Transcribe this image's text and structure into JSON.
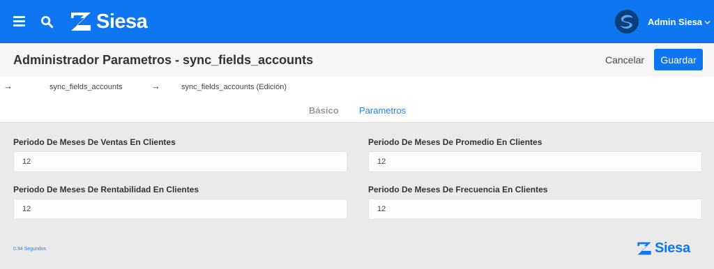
{
  "header": {
    "brand_name": "Siesa",
    "user_name": "Admin Siesa",
    "brand_color": "#0d76f0",
    "icons": [
      "menu-icon",
      "search-icon",
      "siesa-logo-icon",
      "user-avatar",
      "chevron-down-icon"
    ]
  },
  "titlebar": {
    "title": "Administrador Parametros - sync_fields_accounts",
    "cancel_label": "Cancelar",
    "save_label": "Guardar"
  },
  "breadcrumb": {
    "arrow": "→",
    "items": [
      "sync_fields_accounts",
      "sync_fields_accounts (Edición)"
    ]
  },
  "tabs": [
    {
      "label": "Básico",
      "active": false
    },
    {
      "label": "Parametros",
      "active": true
    }
  ],
  "fields": [
    {
      "label": "Periodo De Meses De Ventas En Clientes",
      "value": "12"
    },
    {
      "label": "Periodo De Meses De Promedio En Clientes",
      "value": "12"
    },
    {
      "label": "Periodo De Meses De Rentabilidad En Clientes",
      "value": "12"
    },
    {
      "label": "Periodo De Meses De Frecuencia En Clientes",
      "value": "12"
    }
  ],
  "footer": {
    "timing": "0.34 Segundos",
    "brand_name": "Siesa"
  }
}
